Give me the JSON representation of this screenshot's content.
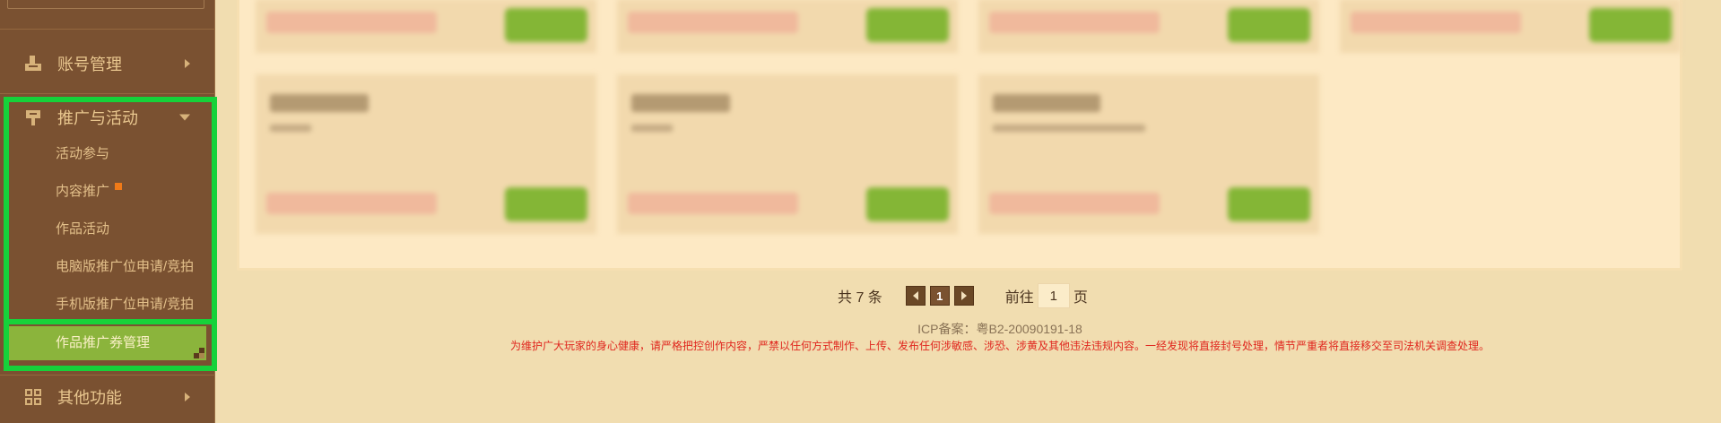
{
  "sidebar": {
    "menus": [
      {
        "label": "账号管理",
        "icon": "account-icon",
        "state": "collapsed"
      },
      {
        "label": "推广与活动",
        "icon": "promotion-icon",
        "state": "expanded"
      },
      {
        "label": "其他功能",
        "icon": "grid-icon",
        "state": "collapsed"
      }
    ],
    "submenu": [
      {
        "label": "活动参与"
      },
      {
        "label": "内容推广",
        "badge": "new"
      },
      {
        "label": "作品活动"
      },
      {
        "label": "电脑版推广位申请/竞拍"
      },
      {
        "label": "手机版推广位申请/竞拍"
      },
      {
        "label": "作品推广券管理",
        "active": true
      }
    ]
  },
  "pagination": {
    "total_text": "共 7 条",
    "current_page": "1",
    "goto_prefix": "前往",
    "goto_value": "1",
    "goto_suffix": "页"
  },
  "footer": {
    "icp": "ICP备案：粤B2-20090191-18",
    "notice": "为维护广大玩家的身心健康，请严格把控创作内容，严禁以任何方式制作、上传、发布任何涉敏感、涉恐、涉黄及其他违法违规内容。一经发现将直接封号处理，情节严重者将直接移交至司法机关调查处理。"
  },
  "colors": {
    "sidebar_bg": "#7a5131",
    "active_item_bg": "#8bb43c",
    "highlight_border": "#16d23a",
    "page_bg": "#f1ddb0",
    "notice_red": "#e0261e"
  }
}
